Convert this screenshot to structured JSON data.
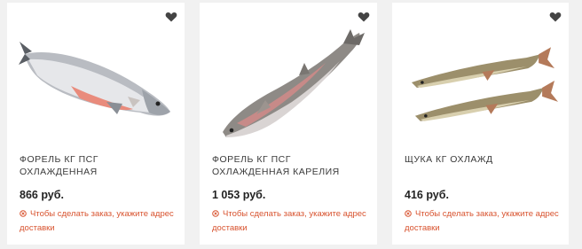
{
  "colors": {
    "background": "#f1f1f1",
    "card": "#ffffff",
    "notice": "#d8532f",
    "favorite_icon": "#444444"
  },
  "products": [
    {
      "name": "ФОРЕЛЬ КГ ПСГ ОХЛАЖДЕННАЯ",
      "price": "866 руб.",
      "notice": "Чтобы сделать заказ, укажите адрес доставки",
      "image_icon": "trout-fish-image",
      "favorite_icon": "heart-icon"
    },
    {
      "name": "ФОРЕЛЬ КГ ПСГ ОХЛАЖДЕННАЯ КАРЕЛИЯ",
      "price": "1 053 руб.",
      "notice": "Чтобы сделать заказ, укажите адрес доставки",
      "image_icon": "trout-fish-image",
      "favorite_icon": "heart-icon"
    },
    {
      "name": "ЩУКА КГ ОХЛАЖД",
      "price": "416 руб.",
      "notice": "Чтобы сделать заказ, укажите адрес доставки",
      "image_icon": "pike-fish-image",
      "favorite_icon": "heart-icon"
    }
  ]
}
